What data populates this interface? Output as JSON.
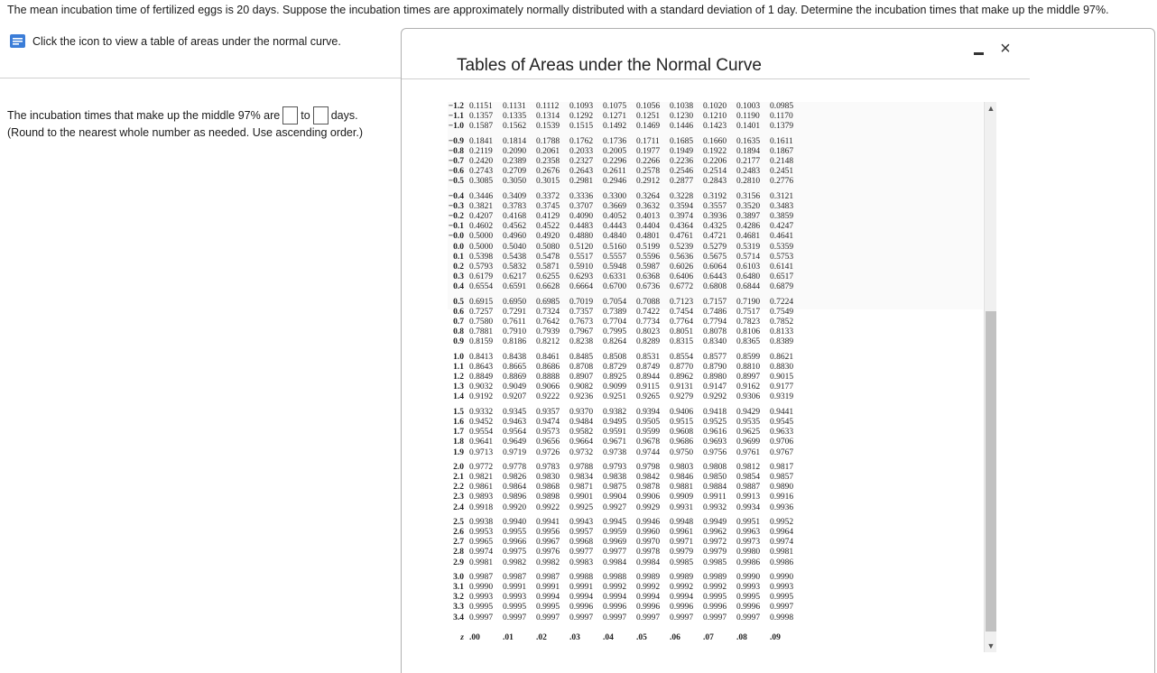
{
  "question": "The mean incubation time of fertilized eggs is 20 days. Suppose the incubation times are approximately normally distributed with a standard deviation of 1 day. Determine the incubation times that make up the middle 97%.",
  "icon_link": {
    "icon": "document-icon",
    "label": "Click the icon to view a table of areas under the normal curve."
  },
  "answer": {
    "prefix": "The incubation times that make up the middle 97% are",
    "to": "to",
    "suffix": "days.",
    "hint": "(Round to the nearest whole number as needed. Use ascending order.)"
  },
  "popup": {
    "title": "Tables of Areas under the Normal Curve",
    "minimize": "minimize-icon",
    "close": "×"
  },
  "table": {
    "header": [
      "z",
      ".00",
      ".01",
      ".02",
      ".03",
      ".04",
      ".05",
      ".06",
      ".07",
      ".08",
      ".09"
    ],
    "groups": [
      [
        [
          "−1.2",
          "0.1151",
          "0.1131",
          "0.1112",
          "0.1093",
          "0.1075",
          "0.1056",
          "0.1038",
          "0.1020",
          "0.1003",
          "0.0985"
        ],
        [
          "−1.1",
          "0.1357",
          "0.1335",
          "0.1314",
          "0.1292",
          "0.1271",
          "0.1251",
          "0.1230",
          "0.1210",
          "0.1190",
          "0.1170"
        ],
        [
          "−1.0",
          "0.1587",
          "0.1562",
          "0.1539",
          "0.1515",
          "0.1492",
          "0.1469",
          "0.1446",
          "0.1423",
          "0.1401",
          "0.1379"
        ]
      ],
      [
        [
          "−0.9",
          "0.1841",
          "0.1814",
          "0.1788",
          "0.1762",
          "0.1736",
          "0.1711",
          "0.1685",
          "0.1660",
          "0.1635",
          "0.1611"
        ],
        [
          "−0.8",
          "0.2119",
          "0.2090",
          "0.2061",
          "0.2033",
          "0.2005",
          "0.1977",
          "0.1949",
          "0.1922",
          "0.1894",
          "0.1867"
        ],
        [
          "−0.7",
          "0.2420",
          "0.2389",
          "0.2358",
          "0.2327",
          "0.2296",
          "0.2266",
          "0.2236",
          "0.2206",
          "0.2177",
          "0.2148"
        ],
        [
          "−0.6",
          "0.2743",
          "0.2709",
          "0.2676",
          "0.2643",
          "0.2611",
          "0.2578",
          "0.2546",
          "0.2514",
          "0.2483",
          "0.2451"
        ],
        [
          "−0.5",
          "0.3085",
          "0.3050",
          "0.3015",
          "0.2981",
          "0.2946",
          "0.2912",
          "0.2877",
          "0.2843",
          "0.2810",
          "0.2776"
        ]
      ],
      [
        [
          "−0.4",
          "0.3446",
          "0.3409",
          "0.3372",
          "0.3336",
          "0.3300",
          "0.3264",
          "0.3228",
          "0.3192",
          "0.3156",
          "0.3121"
        ],
        [
          "−0.3",
          "0.3821",
          "0.3783",
          "0.3745",
          "0.3707",
          "0.3669",
          "0.3632",
          "0.3594",
          "0.3557",
          "0.3520",
          "0.3483"
        ],
        [
          "−0.2",
          "0.4207",
          "0.4168",
          "0.4129",
          "0.4090",
          "0.4052",
          "0.4013",
          "0.3974",
          "0.3936",
          "0.3897",
          "0.3859"
        ],
        [
          "−0.1",
          "0.4602",
          "0.4562",
          "0.4522",
          "0.4483",
          "0.4443",
          "0.4404",
          "0.4364",
          "0.4325",
          "0.4286",
          "0.4247"
        ],
        [
          "−0.0",
          "0.5000",
          "0.4960",
          "0.4920",
          "0.4880",
          "0.4840",
          "0.4801",
          "0.4761",
          "0.4721",
          "0.4681",
          "0.4641"
        ],
        [
          "0.0",
          "0.5000",
          "0.5040",
          "0.5080",
          "0.5120",
          "0.5160",
          "0.5199",
          "0.5239",
          "0.5279",
          "0.5319",
          "0.5359"
        ],
        [
          "0.1",
          "0.5398",
          "0.5438",
          "0.5478",
          "0.5517",
          "0.5557",
          "0.5596",
          "0.5636",
          "0.5675",
          "0.5714",
          "0.5753"
        ],
        [
          "0.2",
          "0.5793",
          "0.5832",
          "0.5871",
          "0.5910",
          "0.5948",
          "0.5987",
          "0.6026",
          "0.6064",
          "0.6103",
          "0.6141"
        ],
        [
          "0.3",
          "0.6179",
          "0.6217",
          "0.6255",
          "0.6293",
          "0.6331",
          "0.6368",
          "0.6406",
          "0.6443",
          "0.6480",
          "0.6517"
        ],
        [
          "0.4",
          "0.6554",
          "0.6591",
          "0.6628",
          "0.6664",
          "0.6700",
          "0.6736",
          "0.6772",
          "0.6808",
          "0.6844",
          "0.6879"
        ]
      ],
      [
        [
          "0.5",
          "0.6915",
          "0.6950",
          "0.6985",
          "0.7019",
          "0.7054",
          "0.7088",
          "0.7123",
          "0.7157",
          "0.7190",
          "0.7224"
        ],
        [
          "0.6",
          "0.7257",
          "0.7291",
          "0.7324",
          "0.7357",
          "0.7389",
          "0.7422",
          "0.7454",
          "0.7486",
          "0.7517",
          "0.7549"
        ],
        [
          "0.7",
          "0.7580",
          "0.7611",
          "0.7642",
          "0.7673",
          "0.7704",
          "0.7734",
          "0.7764",
          "0.7794",
          "0.7823",
          "0.7852"
        ],
        [
          "0.8",
          "0.7881",
          "0.7910",
          "0.7939",
          "0.7967",
          "0.7995",
          "0.8023",
          "0.8051",
          "0.8078",
          "0.8106",
          "0.8133"
        ],
        [
          "0.9",
          "0.8159",
          "0.8186",
          "0.8212",
          "0.8238",
          "0.8264",
          "0.8289",
          "0.8315",
          "0.8340",
          "0.8365",
          "0.8389"
        ]
      ],
      [
        [
          "1.0",
          "0.8413",
          "0.8438",
          "0.8461",
          "0.8485",
          "0.8508",
          "0.8531",
          "0.8554",
          "0.8577",
          "0.8599",
          "0.8621"
        ],
        [
          "1.1",
          "0.8643",
          "0.8665",
          "0.8686",
          "0.8708",
          "0.8729",
          "0.8749",
          "0.8770",
          "0.8790",
          "0.8810",
          "0.8830"
        ],
        [
          "1.2",
          "0.8849",
          "0.8869",
          "0.8888",
          "0.8907",
          "0.8925",
          "0.8944",
          "0.8962",
          "0.8980",
          "0.8997",
          "0.9015"
        ],
        [
          "1.3",
          "0.9032",
          "0.9049",
          "0.9066",
          "0.9082",
          "0.9099",
          "0.9115",
          "0.9131",
          "0.9147",
          "0.9162",
          "0.9177"
        ],
        [
          "1.4",
          "0.9192",
          "0.9207",
          "0.9222",
          "0.9236",
          "0.9251",
          "0.9265",
          "0.9279",
          "0.9292",
          "0.9306",
          "0.9319"
        ]
      ],
      [
        [
          "1.5",
          "0.9332",
          "0.9345",
          "0.9357",
          "0.9370",
          "0.9382",
          "0.9394",
          "0.9406",
          "0.9418",
          "0.9429",
          "0.9441"
        ],
        [
          "1.6",
          "0.9452",
          "0.9463",
          "0.9474",
          "0.9484",
          "0.9495",
          "0.9505",
          "0.9515",
          "0.9525",
          "0.9535",
          "0.9545"
        ],
        [
          "1.7",
          "0.9554",
          "0.9564",
          "0.9573",
          "0.9582",
          "0.9591",
          "0.9599",
          "0.9608",
          "0.9616",
          "0.9625",
          "0.9633"
        ],
        [
          "1.8",
          "0.9641",
          "0.9649",
          "0.9656",
          "0.9664",
          "0.9671",
          "0.9678",
          "0.9686",
          "0.9693",
          "0.9699",
          "0.9706"
        ],
        [
          "1.9",
          "0.9713",
          "0.9719",
          "0.9726",
          "0.9732",
          "0.9738",
          "0.9744",
          "0.9750",
          "0.9756",
          "0.9761",
          "0.9767"
        ]
      ],
      [
        [
          "2.0",
          "0.9772",
          "0.9778",
          "0.9783",
          "0.9788",
          "0.9793",
          "0.9798",
          "0.9803",
          "0.9808",
          "0.9812",
          "0.9817"
        ],
        [
          "2.1",
          "0.9821",
          "0.9826",
          "0.9830",
          "0.9834",
          "0.9838",
          "0.9842",
          "0.9846",
          "0.9850",
          "0.9854",
          "0.9857"
        ],
        [
          "2.2",
          "0.9861",
          "0.9864",
          "0.9868",
          "0.9871",
          "0.9875",
          "0.9878",
          "0.9881",
          "0.9884",
          "0.9887",
          "0.9890"
        ],
        [
          "2.3",
          "0.9893",
          "0.9896",
          "0.9898",
          "0.9901",
          "0.9904",
          "0.9906",
          "0.9909",
          "0.9911",
          "0.9913",
          "0.9916"
        ],
        [
          "2.4",
          "0.9918",
          "0.9920",
          "0.9922",
          "0.9925",
          "0.9927",
          "0.9929",
          "0.9931",
          "0.9932",
          "0.9934",
          "0.9936"
        ]
      ],
      [
        [
          "2.5",
          "0.9938",
          "0.9940",
          "0.9941",
          "0.9943",
          "0.9945",
          "0.9946",
          "0.9948",
          "0.9949",
          "0.9951",
          "0.9952"
        ],
        [
          "2.6",
          "0.9953",
          "0.9955",
          "0.9956",
          "0.9957",
          "0.9959",
          "0.9960",
          "0.9961",
          "0.9962",
          "0.9963",
          "0.9964"
        ],
        [
          "2.7",
          "0.9965",
          "0.9966",
          "0.9967",
          "0.9968",
          "0.9969",
          "0.9970",
          "0.9971",
          "0.9972",
          "0.9973",
          "0.9974"
        ],
        [
          "2.8",
          "0.9974",
          "0.9975",
          "0.9976",
          "0.9977",
          "0.9977",
          "0.9978",
          "0.9979",
          "0.9979",
          "0.9980",
          "0.9981"
        ],
        [
          "2.9",
          "0.9981",
          "0.9982",
          "0.9982",
          "0.9983",
          "0.9984",
          "0.9984",
          "0.9985",
          "0.9985",
          "0.9986",
          "0.9986"
        ]
      ],
      [
        [
          "3.0",
          "0.9987",
          "0.9987",
          "0.9987",
          "0.9988",
          "0.9988",
          "0.9989",
          "0.9989",
          "0.9989",
          "0.9990",
          "0.9990"
        ],
        [
          "3.1",
          "0.9990",
          "0.9991",
          "0.9991",
          "0.9991",
          "0.9992",
          "0.9992",
          "0.9992",
          "0.9992",
          "0.9993",
          "0.9993"
        ],
        [
          "3.2",
          "0.9993",
          "0.9993",
          "0.9994",
          "0.9994",
          "0.9994",
          "0.9994",
          "0.9994",
          "0.9995",
          "0.9995",
          "0.9995"
        ],
        [
          "3.3",
          "0.9995",
          "0.9995",
          "0.9995",
          "0.9996",
          "0.9996",
          "0.9996",
          "0.9996",
          "0.9996",
          "0.9996",
          "0.9997"
        ],
        [
          "3.4",
          "0.9997",
          "0.9997",
          "0.9997",
          "0.9997",
          "0.9997",
          "0.9997",
          "0.9997",
          "0.9997",
          "0.9997",
          "0.9998"
        ]
      ]
    ]
  },
  "scrollbar": {
    "up": "▲",
    "down": "▼"
  }
}
